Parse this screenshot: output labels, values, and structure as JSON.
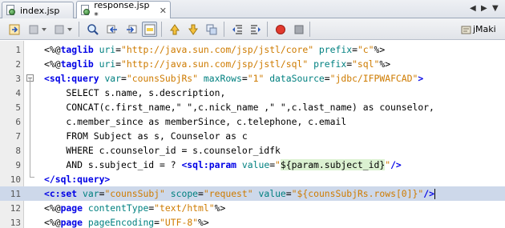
{
  "tabs": [
    {
      "label": "index.jsp",
      "active": false
    },
    {
      "label": "response.jsp *",
      "active": true
    }
  ],
  "tab_nav": {
    "left": "◀",
    "right": "▶",
    "menu": "▼"
  },
  "toolbar": {
    "buttons": [
      "toggle-bookmark-icon",
      "back-icon",
      "forward-icon",
      "find-icon",
      "find-previous-icon",
      "find-next-icon",
      "toggle-highlight-icon",
      "previous-bookmark-icon",
      "next-bookmark-icon",
      "toggle-bookmarks-icon",
      "shift-left-icon",
      "shift-right-icon",
      "start-macro-icon",
      "stop-macro-icon",
      "jmaki-icon"
    ],
    "jmaki_label": "jMaki"
  },
  "editor": {
    "highlighted_line": 11,
    "lines": [
      {
        "n": "1",
        "parts": [
          [
            "p",
            "<%@"
          ],
          [
            "k",
            "taglib"
          ],
          [
            "p",
            " "
          ],
          [
            "a",
            "uri"
          ],
          [
            "p",
            "="
          ],
          [
            "s",
            "\"http://java.sun.com/jsp/jstl/core\""
          ],
          [
            "p",
            " "
          ],
          [
            "a",
            "prefix"
          ],
          [
            "p",
            "="
          ],
          [
            "s",
            "\"c\""
          ],
          [
            "p",
            "%>"
          ]
        ]
      },
      {
        "n": "2",
        "parts": [
          [
            "p",
            "<%@"
          ],
          [
            "k",
            "taglib"
          ],
          [
            "p",
            " "
          ],
          [
            "a",
            "uri"
          ],
          [
            "p",
            "="
          ],
          [
            "s",
            "\"http://java.sun.com/jsp/jstl/sql\""
          ],
          [
            "p",
            " "
          ],
          [
            "a",
            "prefix"
          ],
          [
            "p",
            "="
          ],
          [
            "s",
            "\"sql\""
          ],
          [
            "p",
            "%>"
          ]
        ]
      },
      {
        "n": "3",
        "parts": [
          [
            "k",
            "<sql:query"
          ],
          [
            "p",
            " "
          ],
          [
            "a",
            "var"
          ],
          [
            "p",
            "="
          ],
          [
            "s",
            "\"counsSubjRs\""
          ],
          [
            "p",
            " "
          ],
          [
            "a",
            "maxRows"
          ],
          [
            "p",
            "="
          ],
          [
            "s",
            "\"1\""
          ],
          [
            "p",
            " "
          ],
          [
            "a",
            "dataSource"
          ],
          [
            "p",
            "="
          ],
          [
            "s",
            "\"jdbc/IFPWAFCAD\""
          ],
          [
            "k",
            ">"
          ]
        ]
      },
      {
        "n": "4",
        "parts": [
          [
            "p",
            "    SELECT s.name, s.description,"
          ]
        ]
      },
      {
        "n": "5",
        "parts": [
          [
            "p",
            "    CONCAT(c.first_name,\" \",c.nick_name ,\" \",c.last_name) as counselor,"
          ]
        ]
      },
      {
        "n": "6",
        "parts": [
          [
            "p",
            "    c.member_since as memberSince, c.telephone, c.email"
          ]
        ]
      },
      {
        "n": "7",
        "parts": [
          [
            "p",
            "    FROM Subject as s, Counselor as c"
          ]
        ]
      },
      {
        "n": "8",
        "parts": [
          [
            "p",
            "    WHERE c.counselor_id = s.counselor_idfk"
          ]
        ]
      },
      {
        "n": "9",
        "parts": [
          [
            "p",
            "    AND s.subject_id = ? "
          ],
          [
            "k",
            "<sql:param"
          ],
          [
            "p",
            " "
          ],
          [
            "a",
            "value"
          ],
          [
            "p",
            "="
          ],
          [
            "s",
            "\""
          ],
          [
            "el",
            "${param.subject_id}"
          ],
          [
            "s",
            "\""
          ],
          [
            "k",
            "/>"
          ]
        ]
      },
      {
        "n": "10",
        "parts": [
          [
            "k",
            "</sql:query>"
          ]
        ]
      },
      {
        "n": "11",
        "parts": [
          [
            "k",
            "<c:set"
          ],
          [
            "p",
            " "
          ],
          [
            "a",
            "var"
          ],
          [
            "p",
            "="
          ],
          [
            "s",
            "\"counsSubj\""
          ],
          [
            "p",
            " "
          ],
          [
            "a",
            "scope"
          ],
          [
            "p",
            "="
          ],
          [
            "s",
            "\"request\""
          ],
          [
            "p",
            " "
          ],
          [
            "a",
            "value"
          ],
          [
            "p",
            "="
          ],
          [
            "s",
            "\"${counsSubjRs.rows[0]}\""
          ],
          [
            "k",
            "/>"
          ]
        ]
      },
      {
        "n": "12",
        "parts": [
          [
            "p",
            "<%@"
          ],
          [
            "k",
            "page"
          ],
          [
            "p",
            " "
          ],
          [
            "a",
            "contentType"
          ],
          [
            "p",
            "="
          ],
          [
            "s",
            "\"text/html\""
          ],
          [
            "p",
            "%>"
          ]
        ]
      },
      {
        "n": "13",
        "parts": [
          [
            "p",
            "<%@"
          ],
          [
            "k",
            "page"
          ],
          [
            "p",
            " "
          ],
          [
            "a",
            "pageEncoding"
          ],
          [
            "p",
            "="
          ],
          [
            "s",
            "\"UTF-8\""
          ],
          [
            "p",
            "%>"
          ]
        ]
      }
    ]
  }
}
